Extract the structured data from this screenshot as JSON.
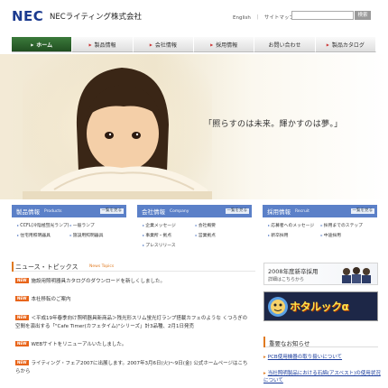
{
  "header": {
    "logo": "NEC",
    "company": "NECライティング株式会社",
    "util_links": [
      "English",
      "｜",
      "サイトマップ"
    ],
    "search_placeholder": "",
    "search_button": "検索"
  },
  "nav": {
    "items": [
      {
        "label": "ホーム",
        "active": true
      },
      {
        "label": "製品情報",
        "active": false
      },
      {
        "label": "会社情報",
        "active": false
      },
      {
        "label": "採用情報",
        "active": false
      },
      {
        "label": "お問い合わせ",
        "active": false
      },
      {
        "label": "製品カタログ",
        "active": false
      }
    ]
  },
  "hero": {
    "tagline": "「照らすのは未来。輝かすのは夢。」"
  },
  "columns": [
    {
      "title": "製品情報",
      "sub": "Products",
      "more": "一覧を見る",
      "items": [
        "CCFL(冷陰極蛍光ランプ)",
        "一般ランプ",
        "住宅用照明器具",
        "施設用照明器具"
      ]
    },
    {
      "title": "会社情報",
      "sub": "Company",
      "more": "一覧を見る",
      "items": [
        "企業メッセージ",
        "会社概要",
        "事業所・拠点",
        "営業拠点",
        "プレスリリース"
      ]
    },
    {
      "title": "採用情報",
      "sub": "Recruit",
      "more": "一覧を見る",
      "items": [
        "応募者へのメッセージ",
        "採用までのステップ",
        "新卒採用",
        "中途採用"
      ]
    }
  ],
  "news": {
    "title": "ニュース・トピックス",
    "sub": "News Topics",
    "new_badge": "NEW",
    "items": [
      {
        "text": "施設用照明器具カタログのダウンロードを新しくしました。",
        "new": true
      },
      {
        "text": "本社移転のご案内",
        "new": true
      },
      {
        "text": "＜平成19年春季向け照明器具新商品＞残光形スリム蛍光灯ランプ搭載カフェのような くつろぎの空間を演出する「\"Cafe Timer(カフェタイム)\"シリーズ」計3品種、2月1日発売",
        "new": true
      },
      {
        "text": "WEBサイトをリニューアルいたしました。",
        "new": true
      },
      {
        "text": "ライティング・フェア2007に出展します。2007年3月6日(火)～9日(金) 公式ホームページはこちらから",
        "new": true
      }
    ]
  },
  "banners": {
    "recruit_line1": "2008年度新卒採用",
    "recruit_line2": "詳細はこちらから",
    "hotaluck": "ホタルックα"
  },
  "notice": {
    "title": "重要なお知らせ",
    "items": [
      "PCB使用機器の取り扱いについて",
      "当社照明製品における石綿(アスベスト)の使用状況について"
    ]
  },
  "colors": {
    "brand_blue": "#1b3a8f",
    "nav_active": "#2f6a2f",
    "column_head": "#5b80c8",
    "accent_orange": "#e07a20",
    "link_blue": "#1a3c9c"
  }
}
